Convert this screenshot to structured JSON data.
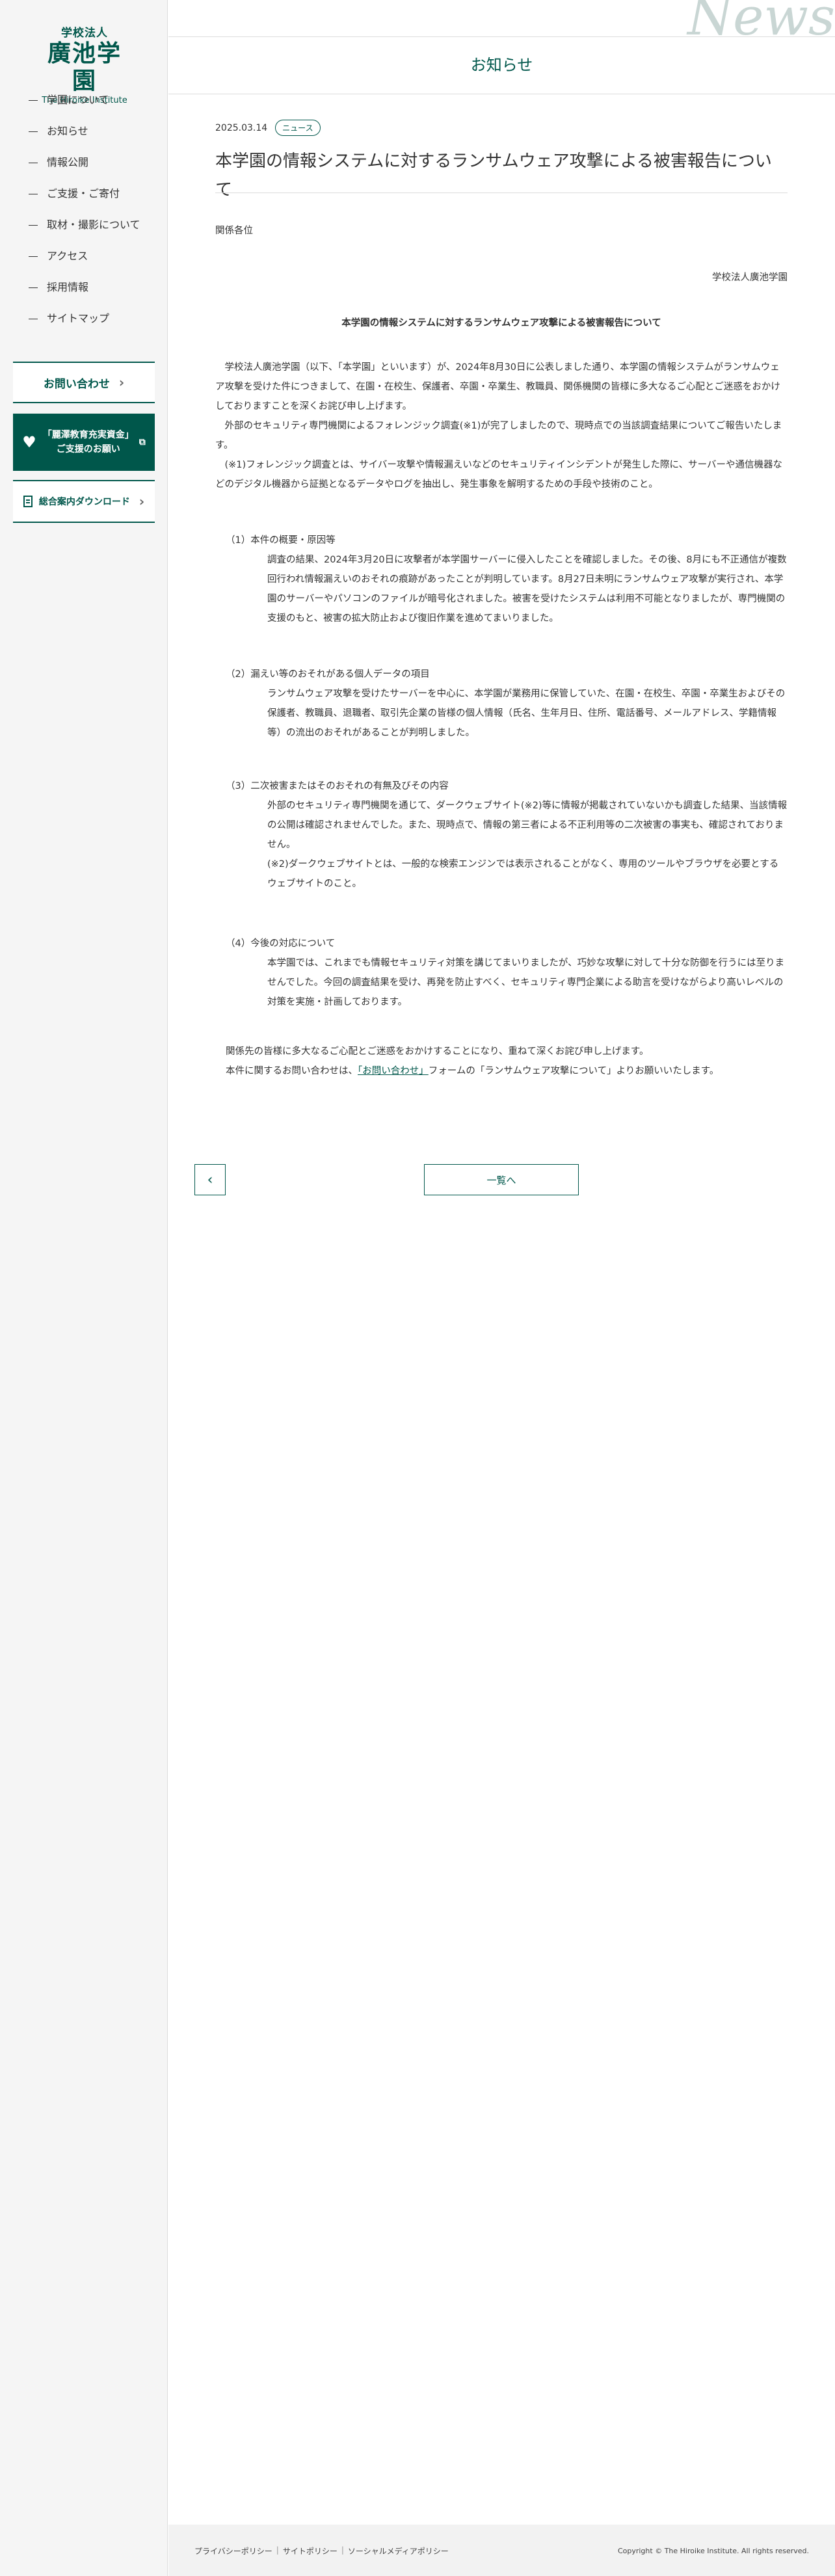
{
  "logo": {
    "top": "学校法人",
    "main": "廣池学園",
    "en": "The Hiroike Institute"
  },
  "nav": [
    "学園について",
    "お知らせ",
    "情報公開",
    "ご支援・ご寄付",
    "取材・撮影について",
    "アクセス",
    "採用情報",
    "サイトマップ"
  ],
  "sidebar_buttons": {
    "contact": "お問い合わせ",
    "donate_line1": "「麗澤教育充実資金」",
    "donate_line2": "ご支援のお願い",
    "download": "総合案内ダウンロード"
  },
  "header": {
    "deco": "News",
    "page_heading": "お知らせ"
  },
  "article": {
    "date": "2025.03.14",
    "tag": "ニュース",
    "title": "本学園の情報システムに対するランサムウェア攻撃による被害報告について",
    "addressee": "関係各位",
    "sender": "学校法人廣池学園",
    "subject": "本学園の情報システムに対するランサムウェア攻撃による被害報告について",
    "intro": [
      "　学校法人廣池学園（以下、「本学園」といいます）が、2024年8月30日に公表しました通り、本学園の情報システムがランサムウェア攻撃を受けた件につきまして、在園・在校生、保護者、卒園・卒業生、教職員、関係機関の皆様に多大なるご心配とご迷惑をおかけしておりますことを深くお詫び申し上げます。",
      "　外部のセキュリティ専門機関によるフォレンジック調査(※1)が完了しましたので、現時点での当該調査結果についてご報告いたします。",
      "　(※1)フォレンジック調査とは、サイバー攻撃や情報漏えいなどのセキュリティインシデントが発生した際に、サーバーや通信機器などのデジタル機器から証拠となるデータやログを抽出し、発生事象を解明するための手段や技術のこと。"
    ],
    "sections": [
      {
        "heading": "（1）本件の概要・原因等",
        "body": [
          "調査の結果、2024年3月20日に攻撃者が本学園サーバーに侵入したことを確認しました。その後、8月にも不正通信が複数回行われ情報漏えいのおそれの痕跡があったことが判明しています。8月27日未明にランサムウェア攻撃が実行され、本学園のサーバーやパソコンのファイルが暗号化されました。被害を受けたシステムは利用不可能となりましたが、専門機関の支援のもと、被害の拡大防止および復旧作業を進めてまいりました。"
        ]
      },
      {
        "heading": "（2）漏えい等のおそれがある個人データの項目",
        "body": [
          "ランサムウェア攻撃を受けたサーバーを中心に、本学園が業務用に保管していた、在園・在校生、卒園・卒業生およびその保護者、教職員、退職者、取引先企業の皆様の個人情報（氏名、生年月日、住所、電話番号、メールアドレス、学籍情報等）の流出のおそれがあることが判明しました。"
        ]
      },
      {
        "heading": "（3）二次被害またはそのおそれの有無及びその内容",
        "body": [
          "外部のセキュリティ専門機関を通じて、ダークウェブサイト(※2)等に情報が掲載されていないかも調査した結果、当該情報の公開は確認されませんでした。また、現時点で、情報の第三者による不正利用等の二次被害の事実も、確認されておりません。",
          "(※2)ダークウェブサイトとは、一般的な検索エンジンでは表示されることがなく、専用のツールやブラウザを必要とするウェブサイトのこと。"
        ]
      },
      {
        "heading": "（4）今後の対応について",
        "body": [
          "本学園では、これまでも情報セキュリティ対策を講じてまいりましたが、巧妙な攻撃に対して十分な防御を行うには至りませんでした。今回の調査結果を受け、再発を防止すべく、セキュリティ専門企業による助言を受けながらより高いレベルの対策を実施・計画しております。"
        ]
      }
    ],
    "closing1": "関係先の皆様に多大なるご心配とご迷惑をおかけすることになり、重ねて深くお詫び申し上げます。",
    "closing2_pre": "本件に関するお問い合わせは、",
    "closing2_link": "「お問い合わせ」",
    "closing2_post": "フォームの「ランサムウェア攻撃について」よりお願いいたします。"
  },
  "pager": {
    "prev_icon": "chevron-left-icon",
    "list_label": "一覧へ"
  },
  "footer": {
    "links": [
      "プライバシーポリシー",
      "サイトポリシー",
      "ソーシャルメディアポリシー"
    ],
    "copyright": "Copyright © The Hiroike Institute. All rights reserved."
  },
  "colors": {
    "brand": "#00574b",
    "sidebar_bg": "#f5f5f5",
    "footer_bg": "#f2f2f2"
  }
}
